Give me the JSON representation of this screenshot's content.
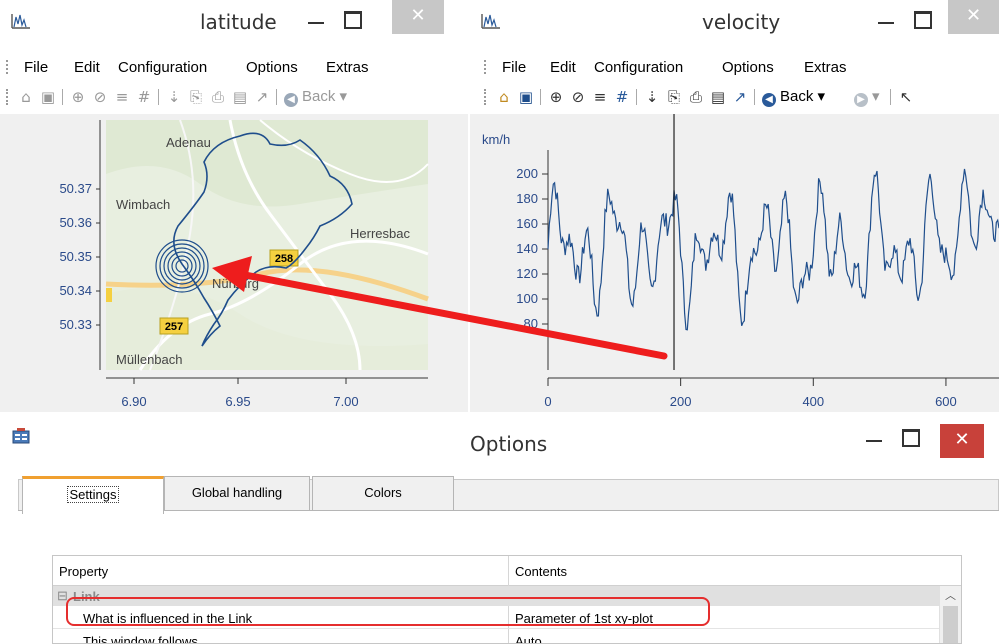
{
  "latitude_window": {
    "title": "latitude",
    "menu": [
      "File",
      "Edit",
      "Configuration",
      "Options",
      "Extras"
    ],
    "toolbar_back_label": "Back",
    "map_labels": [
      "Adenau",
      "Wimbach",
      "Herresbac",
      "Nürburg",
      "Müllenbach"
    ],
    "road_badges": [
      "258",
      "257"
    ],
    "y_ticks": [
      "50.37",
      "50.36",
      "50.35",
      "50.34",
      "50.33"
    ],
    "x_ticks": [
      "6.90",
      "6.95",
      "7.00"
    ]
  },
  "velocity_window": {
    "title": "velocity",
    "menu": [
      "File",
      "Edit",
      "Configuration",
      "Options",
      "Extras"
    ],
    "toolbar_back_label": "Back",
    "y_unit": "km/h",
    "y_ticks": [
      "200",
      "180",
      "160",
      "140",
      "120",
      "100",
      "80"
    ],
    "x_ticks": [
      "0",
      "200",
      "400",
      "600"
    ],
    "cursor_x": 190,
    "line_color": "#1f4e8c"
  },
  "options_window": {
    "title": "Options",
    "tabs": [
      "Settings",
      "Global handling",
      "Colors"
    ],
    "active_tab": "Settings",
    "grid": {
      "columns": [
        "Property",
        "Contents"
      ],
      "category": "Link",
      "rows": [
        {
          "property": "What is influenced in the Link",
          "contents": "Parameter of 1st xy-plot"
        },
        {
          "property": "This window follows",
          "contents": "Auto"
        }
      ]
    }
  },
  "colors": {
    "highlight_red": "#e52e2e",
    "arrow_red": "#ee1d1d",
    "tab_accent": "#f0a030",
    "close_button_red": "#c8413a"
  },
  "icons": [
    "app-chart-icon",
    "options-window-icon",
    "back-arrow-icon",
    "zoom-icon",
    "print-icon"
  ]
}
